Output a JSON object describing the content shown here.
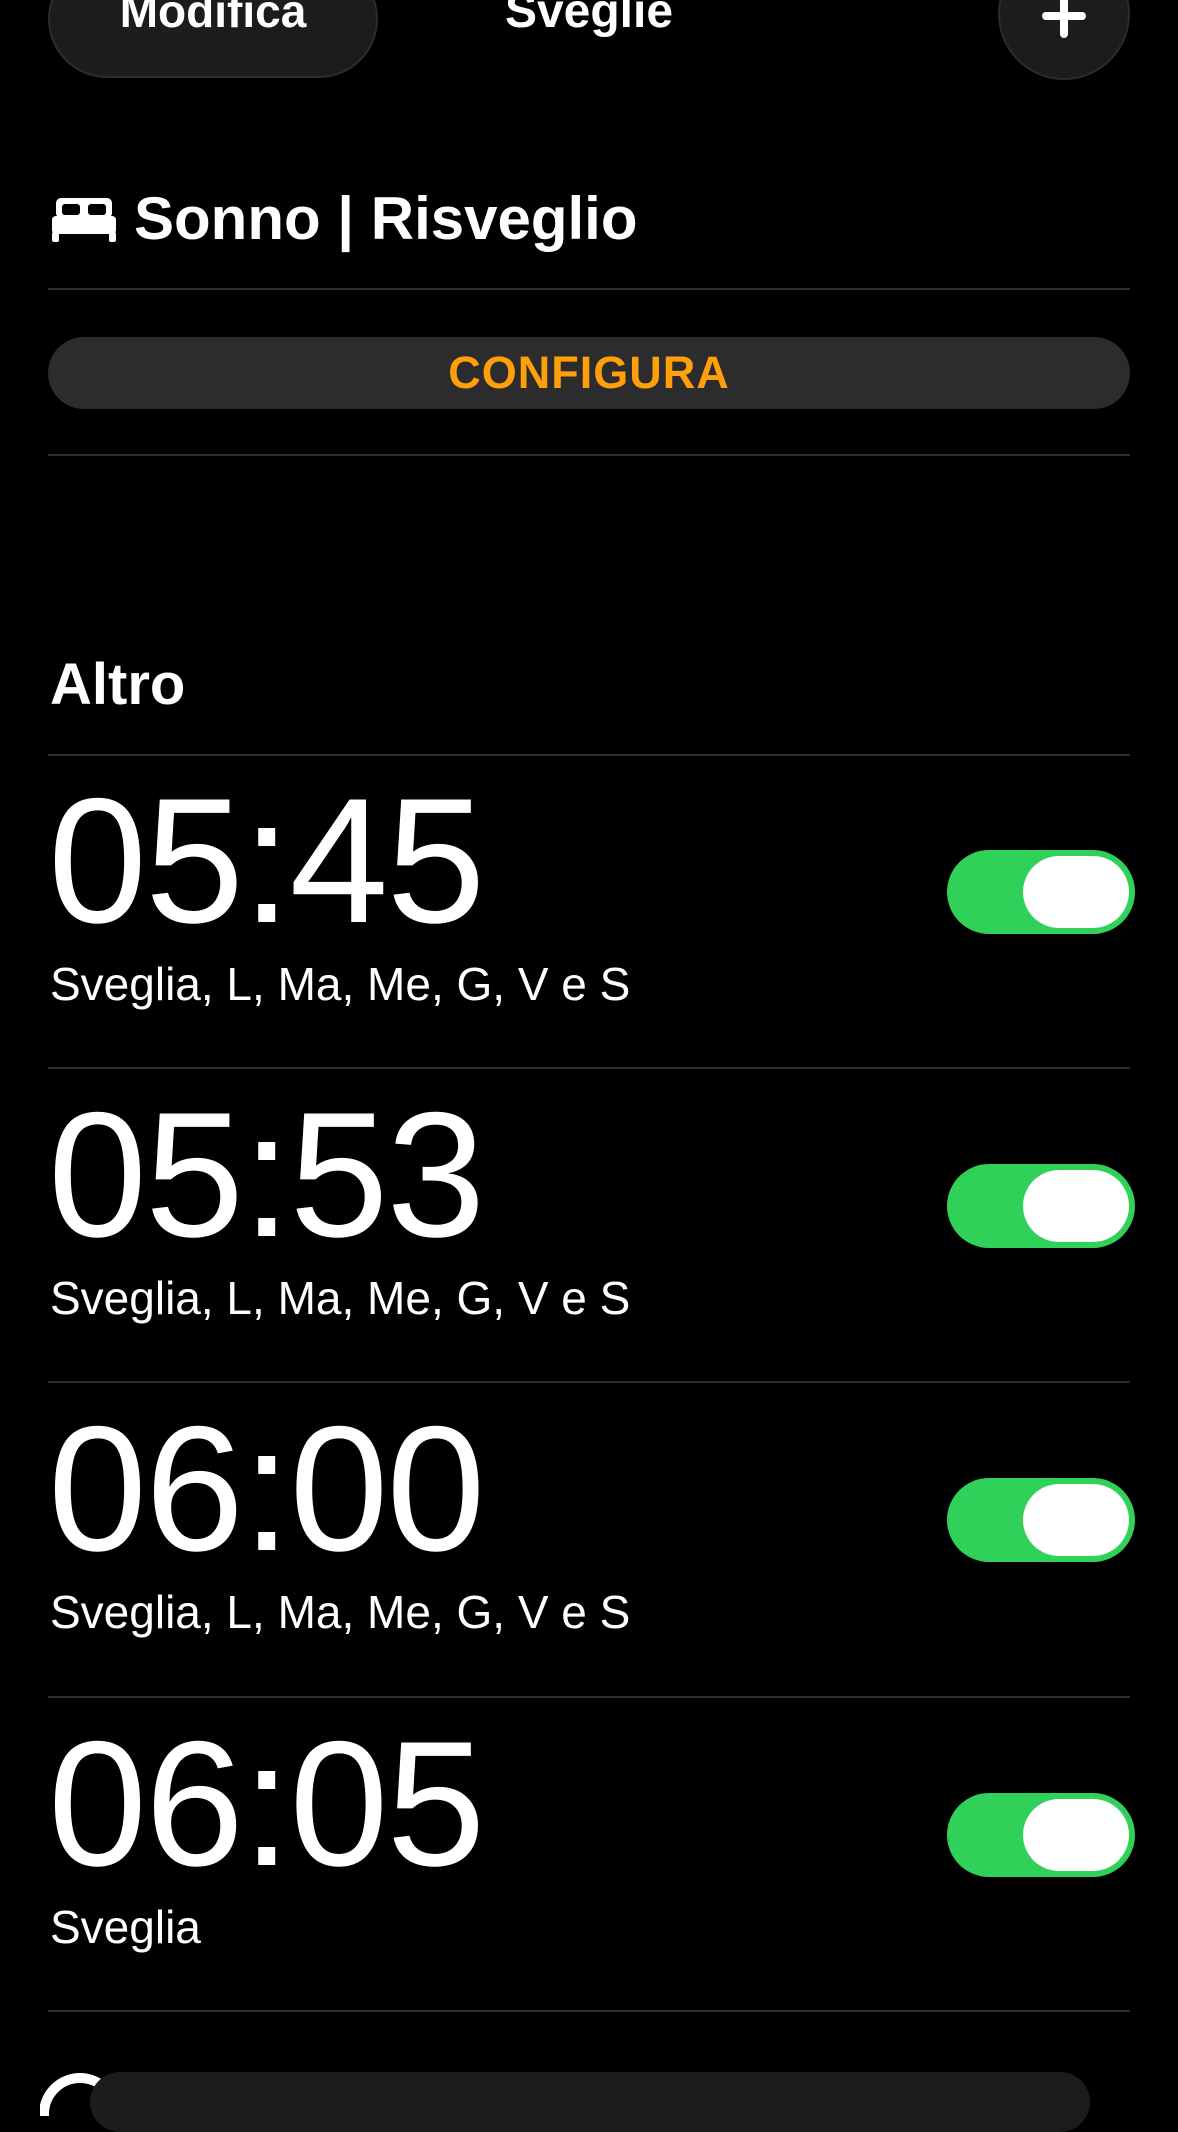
{
  "nav": {
    "edit_label": "Modifica",
    "title": "Sveglie",
    "add_icon": "plus-icon"
  },
  "sleep": {
    "icon": "bed-icon",
    "title": "Sonno | Risveglio",
    "configure_label": "CONFIGURA"
  },
  "other": {
    "section_title": "Altro",
    "alarms": [
      {
        "time": "05:45",
        "label": "Sveglia, L, Ma, Me, G, V e S",
        "enabled": true
      },
      {
        "time": "05:53",
        "label": "Sveglia, L, Ma, Me, G, V e S",
        "enabled": true
      },
      {
        "time": "06:00",
        "label": "Sveglia, L, Ma, Me, G, V e S",
        "enabled": true
      },
      {
        "time": "06:05",
        "label": "Sveglia",
        "enabled": true
      }
    ]
  },
  "colors": {
    "background": "#000000",
    "accent_orange": "#ff9f0a",
    "toggle_on": "#30d158",
    "button_bg": "#2c2c2e",
    "divider": "#2c2c2e"
  }
}
